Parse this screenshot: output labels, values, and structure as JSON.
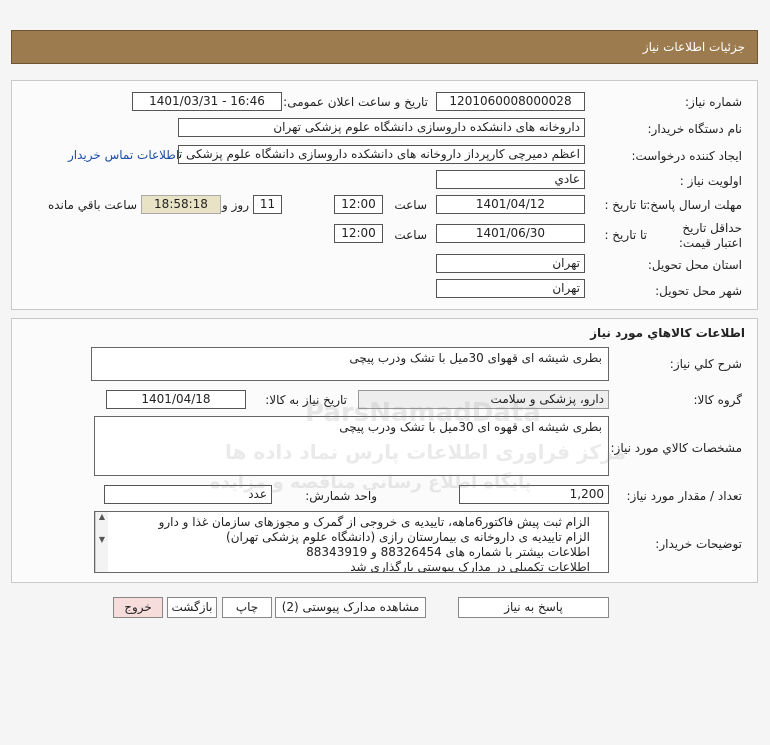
{
  "header": {
    "title": "جزئیات اطلاعات نیاز"
  },
  "info": {
    "need_number_label": "شماره نیاز:",
    "need_number": "1201060008000028",
    "announce_label": "تاریخ و ساعت اعلان عمومی:",
    "announce_value": "1401/03/31 - 16:46",
    "buyer_org_label": "نام دستگاه خریدار:",
    "buyer_org": "داروخانه های دانشکده داروسازی دانشگاه علوم پزشکی تهران",
    "creator_label": "ایجاد کننده درخواست:",
    "creator": "اعظم دمیرچی کارپرداز داروخانه های دانشکده داروسازی دانشگاه علوم پزشکی تهران",
    "contact_link": "اطلاعات تماس خریدار",
    "priority_label": "اولویت نیاز :",
    "priority": "عادي",
    "deadline_label": "مهلت ارسال پاسخ:",
    "to_date_label": "تا تاریخ :",
    "deadline_date": "1401/04/12",
    "time_label": "ساعت",
    "deadline_time": "12:00",
    "days_value": "11",
    "days_label": "روز و",
    "remaining_time": "18:58:18",
    "remaining_label": "ساعت باقي مانده",
    "validity_label": "حداقل تاریخ اعتبار قیمت:",
    "validity_to_label": "تا تاریخ :",
    "validity_date": "1401/06/30",
    "validity_time_label": "ساعت",
    "validity_time": "12:00",
    "province_label": "استان محل تحویل:",
    "province": "تهران",
    "city_label": "شهر محل تحویل:",
    "city": "تهران"
  },
  "goods": {
    "section_title": "اطلاعات کالاهاي مورد نياز",
    "summary_label": "شرح کلي نياز:",
    "summary": "بطری شیشه ای قهوای 30میل با تشک ودرب پیچی",
    "group_label": "گروه کالا:",
    "group": "دارو، پزشکی و سلامت",
    "need_date_label": "تاریخ نیاز به کالا:",
    "need_date": "1401/04/18",
    "spec_label": "مشخصات کالاي مورد نياز:",
    "spec": "بطری شیشه ای قهوه ای 30میل با تشک ودرب پیچی",
    "qty_label": "تعداد / مقدار مورد نیاز:",
    "qty": "1,200",
    "unit_label": "واحد شمارش:",
    "unit": "عدد",
    "notes_label": "توضیحات خریدار:",
    "notes": [
      "الزام ثبت پیش فاکتور6ماهه، تاییدیه ی خروجی از گمرک و مجوزهای سازمان غذا و دارو",
      "الزام تاییدیه ی داروخانه ی بیمارستان رازی (دانشگاه علوم پزشکی تهران)",
      "اطلاعات بیشتر با شماره های 88326454 و 88343919",
      "اطلاعات تکمیلی در مدارک پیوستی بارگذاری شد"
    ]
  },
  "buttons": {
    "reply": "پاسخ به نیاز",
    "view_docs": "مشاهده مدارک پیوستی (2)",
    "print": "چاپ",
    "back": "بازگشت",
    "exit": "خروج"
  },
  "watermark": {
    "brand": "ParsNamadData",
    "line1": "مرکز فراوری اطلاعات پارس نماد داده ها",
    "line2": "پایگاه اطلاع رسانی مناقصه و مزایده"
  }
}
